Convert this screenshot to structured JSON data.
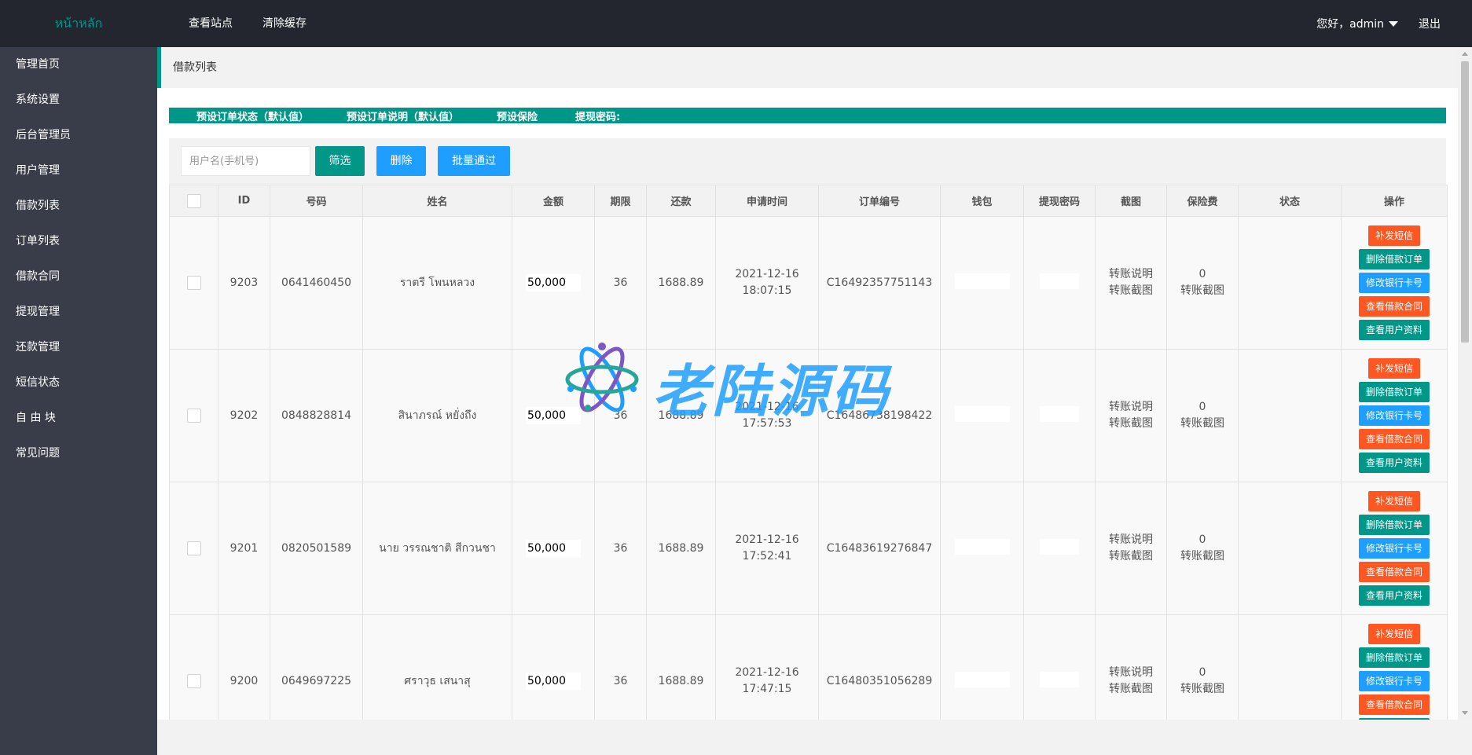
{
  "header": {
    "logo": "หน้าหลัก",
    "nav": [
      "查看站点",
      "清除缓存"
    ],
    "greeting": "您好，admin",
    "logout": "退出"
  },
  "sidebar": {
    "items": [
      "管理首页",
      "系统设置",
      "后台管理员",
      "用户管理",
      "借款列表",
      "订单列表",
      "借款合同",
      "提现管理",
      "还款管理",
      "短信状态",
      "自 由 块",
      "常见问题"
    ]
  },
  "breadcrumb": "借款列表",
  "presets": [
    "预设订单状态（默认值）",
    "预设订单说明（默认值）",
    "预设保险",
    "提现密码:"
  ],
  "toolbar": {
    "search_placeholder": "用户名(手机号)",
    "filter": "筛选",
    "delete": "删除",
    "batch": "批量通过"
  },
  "table": {
    "headers": [
      "ID",
      "号码",
      "姓名",
      "金额",
      "期限",
      "还款",
      "申请时间",
      "订单编号",
      "钱包",
      "提现密码",
      "截图",
      "保险费",
      "状态",
      "操作"
    ],
    "rows": [
      {
        "id": "9203",
        "phone": "0641460450",
        "name": "ราตรี โพนหลวง",
        "amount": "50,000",
        "term": "36",
        "repay": "1688.89",
        "date": "2021-12-16",
        "time": "18:07:15",
        "order": "C16492357751143",
        "shot1": "转账说明",
        "shot2": "转账截图",
        "fee": "0",
        "fee_shot": "转账截图"
      },
      {
        "id": "9202",
        "phone": "0848828814",
        "name": "สินาภรณ์ หยั่งถึง",
        "amount": "50,000",
        "term": "36",
        "repay": "1688.89",
        "date": "2021-12-16",
        "time": "17:57:53",
        "order": "C16486738198422",
        "shot1": "转账说明",
        "shot2": "转账截图",
        "fee": "0",
        "fee_shot": "转账截图"
      },
      {
        "id": "9201",
        "phone": "0820501589",
        "name": "นาย วรรณชาติ สีกวนชา",
        "amount": "50,000",
        "term": "36",
        "repay": "1688.89",
        "date": "2021-12-16",
        "time": "17:52:41",
        "order": "C16483619276847",
        "shot1": "转账说明",
        "shot2": "转账截图",
        "fee": "0",
        "fee_shot": "转账截图"
      },
      {
        "id": "9200",
        "phone": "0649697225",
        "name": "ศราวุธ เสนาสุ",
        "amount": "50,000",
        "term": "36",
        "repay": "1688.89",
        "date": "2021-12-16",
        "time": "17:47:15",
        "order": "C16480351056289",
        "shot1": "转账说明",
        "shot2": "转账截图",
        "fee": "0",
        "fee_shot": "转账截图"
      }
    ],
    "ops": {
      "resend_sms": "补发短信",
      "delete_order": "删除借款订单",
      "edit_card": "修改银行卡号",
      "view_contract": "查看借款合同",
      "view_user": "查看用户资料"
    }
  },
  "watermark": "老陆源码",
  "colors": {
    "header": "#23262e",
    "sidebar": "#393d49",
    "accent": "#009688",
    "blue": "#1e9fff",
    "orange": "#ff5722"
  }
}
